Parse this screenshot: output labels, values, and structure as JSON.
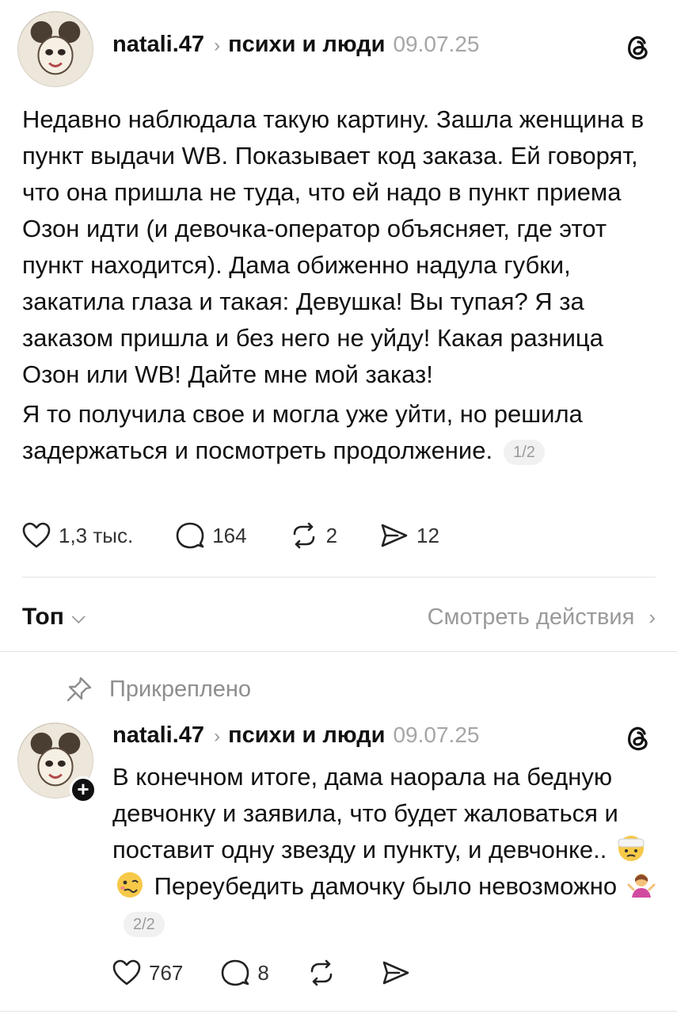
{
  "post1": {
    "username": "natali.47",
    "community": "психи и люди",
    "date": "09.07.25",
    "paragraph1": "Недавно наблюдала такую картину. Зашла женщина в пункт выдачи WB. Показывает код заказа. Ей говорят, что она пришла не туда, что ей надо в пункт приема Озон идти (и девочка-оператор объясняет, где этот пункт находится). Дама обиженно надула губки, закатила глаза и такая: Девушка! Вы тупая? Я за заказом пришла и без него не уйду! Какая разница Озон или WB! Дайте мне мой заказ!",
    "paragraph2": "Я то получила свое и могла уже уйти, но решила задержаться и посмотреть продолжение.",
    "pager": "1/2",
    "likes": "1,3 тыс.",
    "comments": "164",
    "reposts": "2",
    "shares": "12"
  },
  "sort_bar": {
    "label": "Топ",
    "activity_link": "Смотреть действия"
  },
  "pinned_label": "Прикреплено",
  "post2": {
    "username": "natali.47",
    "community": "психи и люди",
    "date": "09.07.25",
    "text_part1": "В конечном итоге, дама наорала на бедную девчонку и заявила, что будет жаловаться и поставит одну звезду и пункту, и девчонке..",
    "text_part2": "Переубедить дамочку было невозможно",
    "pager": "2/2",
    "likes": "767",
    "comments": "8"
  },
  "icons": {
    "threads": "threads-logo-icon",
    "like": "heart-icon",
    "comment": "comment-bubble-icon",
    "repost": "repost-icon",
    "share": "send-icon",
    "pin": "pin-icon"
  }
}
